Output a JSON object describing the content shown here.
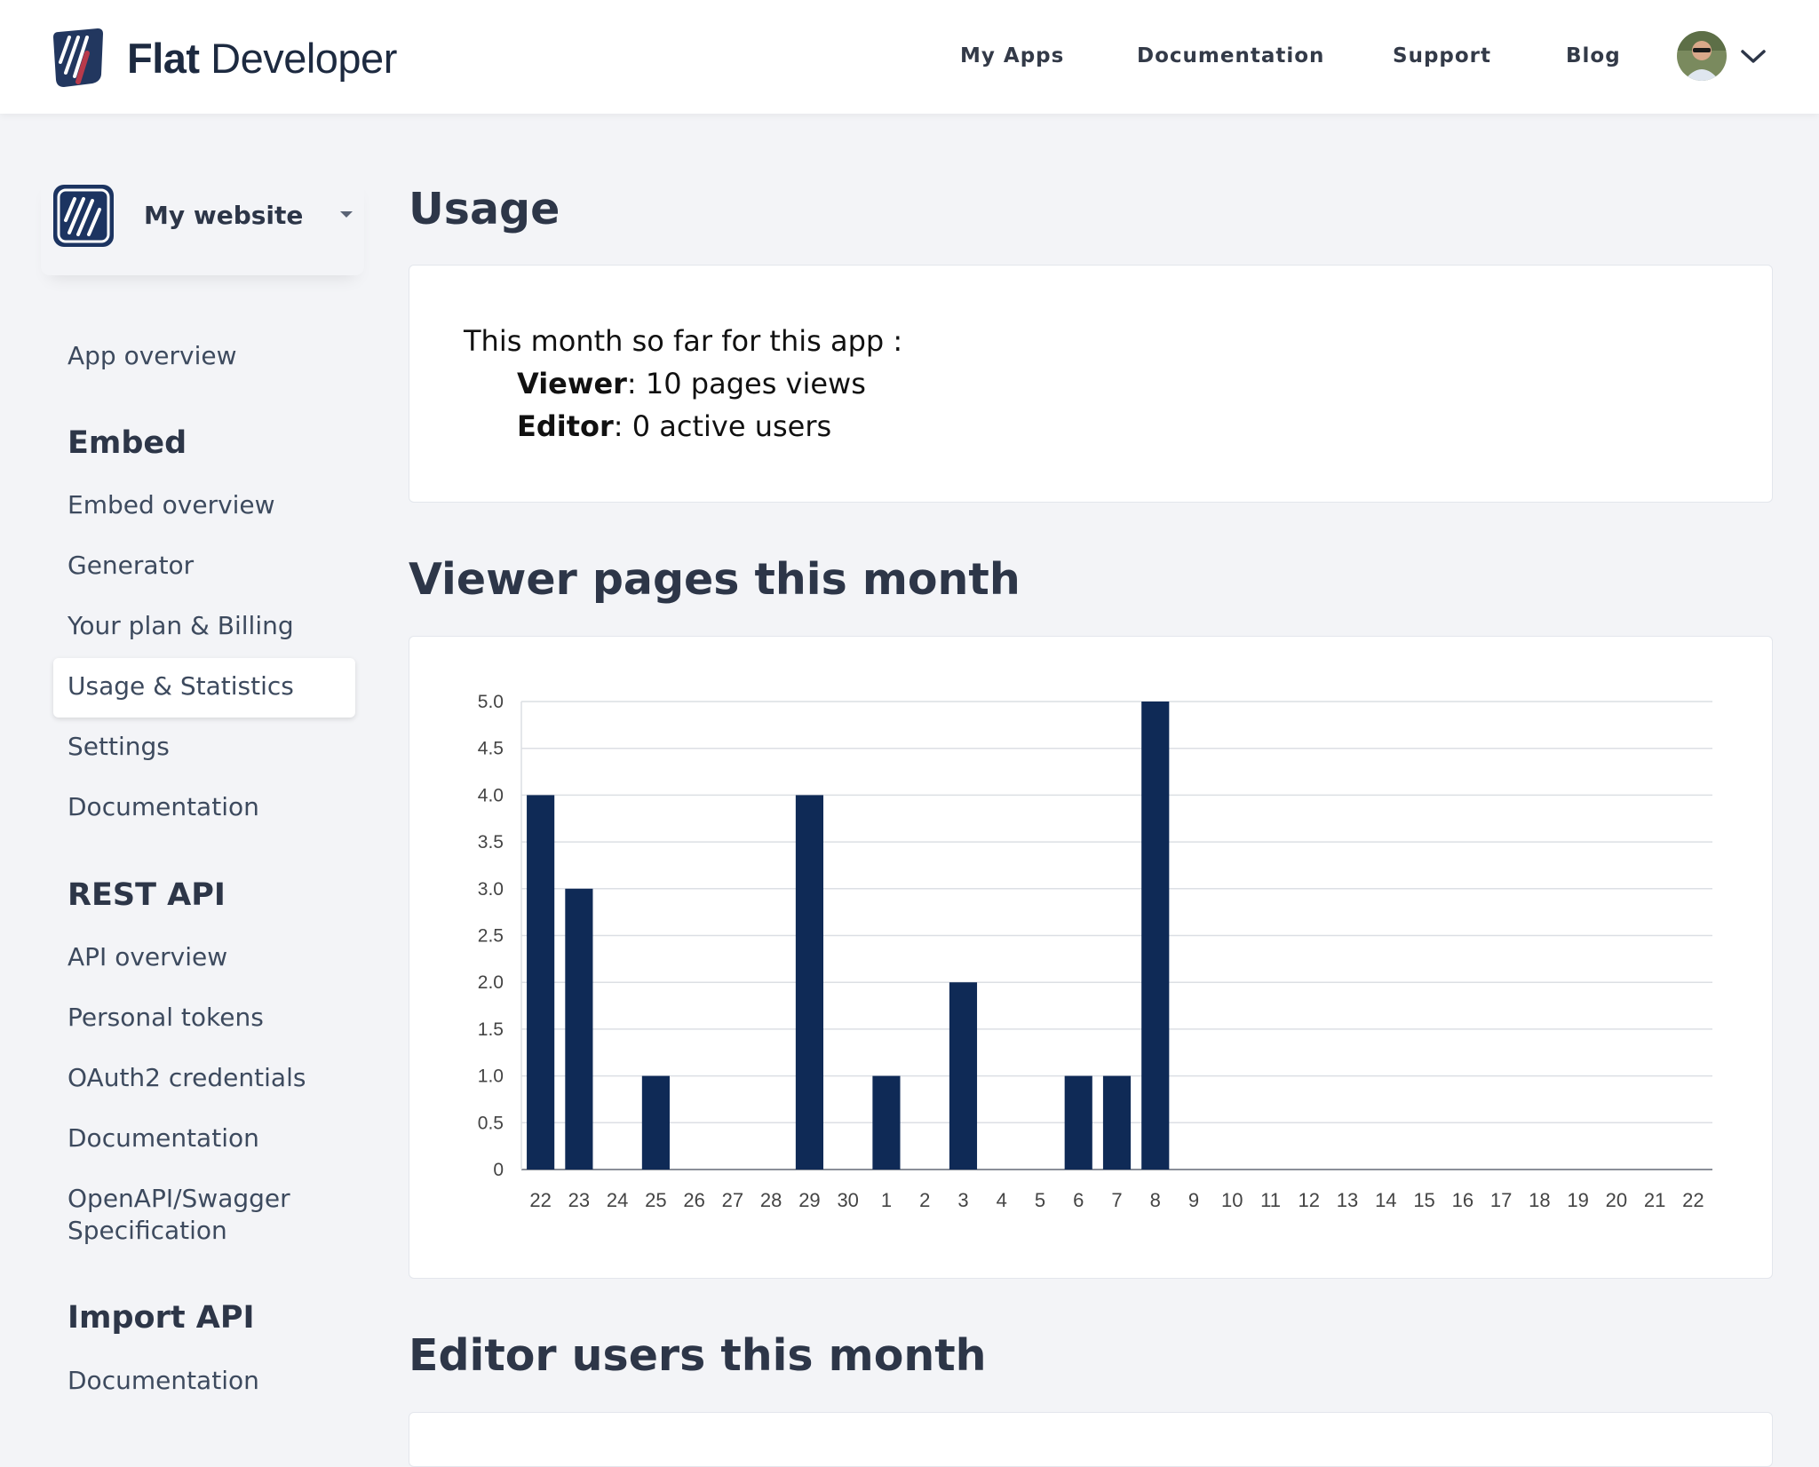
{
  "header": {
    "brand": {
      "bold": "Flat",
      "rest": " Developer"
    },
    "nav": [
      "My Apps",
      "Documentation",
      "Support",
      "Blog"
    ]
  },
  "sidebar": {
    "app_name": "My website",
    "overview": "App overview",
    "sections": [
      {
        "title": "Embed",
        "items": [
          "Embed overview",
          "Generator",
          "Your plan & Billing",
          "Usage & Statistics",
          "Settings",
          "Documentation"
        ]
      },
      {
        "title": "REST API",
        "items": [
          "API overview",
          "Personal tokens",
          "OAuth2 credentials",
          "Documentation",
          "OpenAPI/Swagger",
          "Specification"
        ]
      },
      {
        "title": "Import API",
        "items": [
          "Documentation"
        ]
      }
    ],
    "active_item": "Usage & Statistics"
  },
  "main": {
    "title": "Usage",
    "summary": {
      "intro": "This month so far for this app :",
      "viewer_label": "Viewer",
      "viewer_value": ": 10 pages views",
      "editor_label": "Editor",
      "editor_value": ": 0 active users"
    },
    "viewer_section_title": "Viewer pages this month",
    "editor_section_title": "Editor users this month"
  },
  "colors": {
    "bar": "#0f2a56",
    "page_bg": "#f3f4f7",
    "text": "#2d3648"
  },
  "chart_data": {
    "type": "bar",
    "categories": [
      "22",
      "23",
      "24",
      "25",
      "26",
      "27",
      "28",
      "29",
      "30",
      "1",
      "2",
      "3",
      "4",
      "5",
      "6",
      "7",
      "8",
      "9",
      "10",
      "11",
      "12",
      "13",
      "14",
      "15",
      "16",
      "17",
      "18",
      "19",
      "20",
      "21",
      "22"
    ],
    "values": [
      4,
      3,
      0,
      1,
      0,
      0,
      0,
      4,
      0,
      1,
      0,
      2,
      0,
      0,
      1,
      1,
      5,
      0,
      0,
      0,
      0,
      0,
      0,
      0,
      0,
      0,
      0,
      0,
      0,
      0,
      0
    ],
    "yticks": [
      "0",
      "0.5",
      "1.0",
      "1.5",
      "2.0",
      "2.5",
      "3.0",
      "3.5",
      "4.0",
      "4.5",
      "5.0"
    ],
    "ylim": [
      0,
      5
    ],
    "grid": true
  }
}
